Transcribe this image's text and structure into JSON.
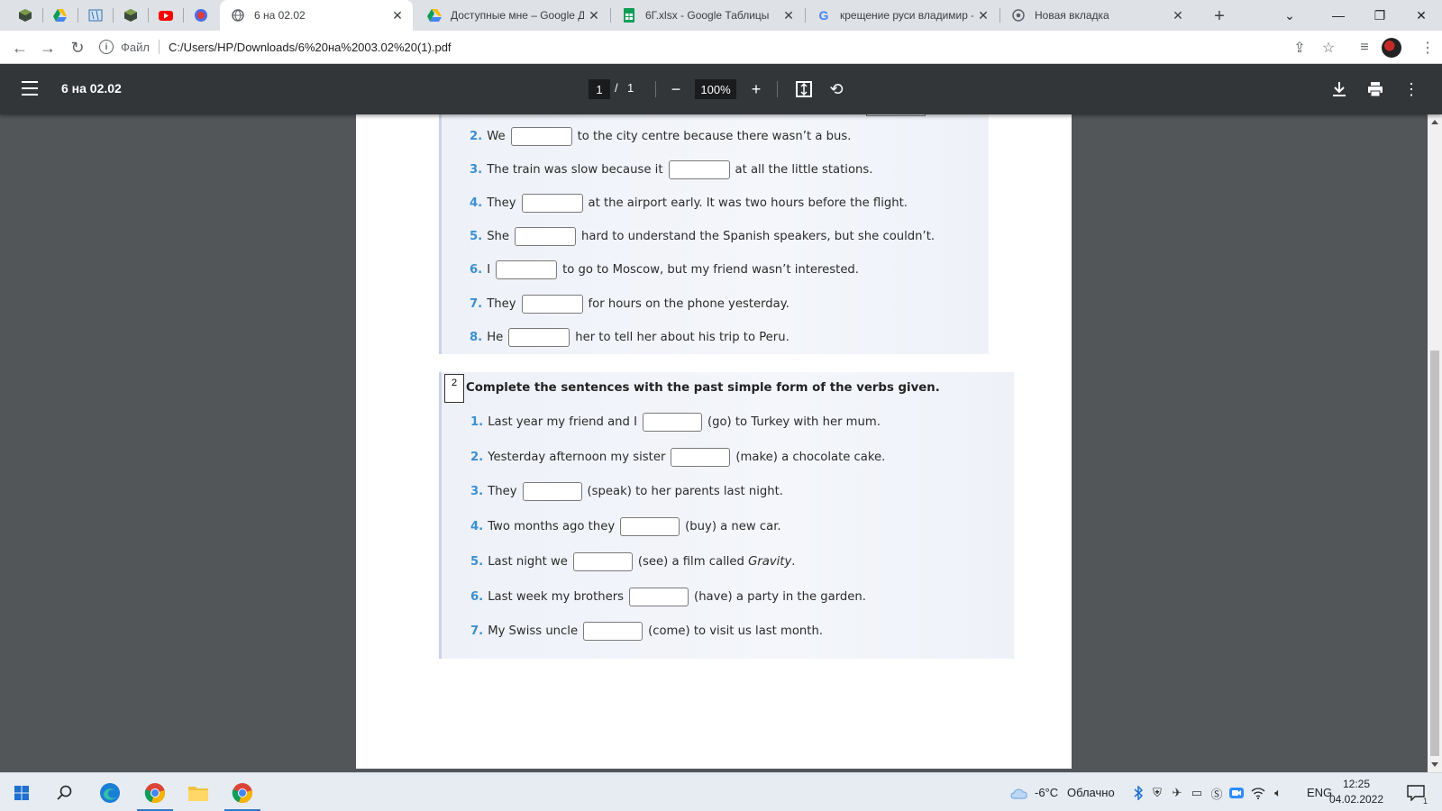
{
  "browser": {
    "tabs": [
      {
        "title": "6 на 02.02",
        "active": true,
        "icon": "globe-icon"
      },
      {
        "title": "Доступные мне – Google Ди",
        "active": false,
        "icon": "google-drive-icon"
      },
      {
        "title": "6Г.xlsx - Google Таблицы",
        "active": false,
        "icon": "google-sheets-icon"
      },
      {
        "title": "крещение руси владимир -",
        "active": false,
        "icon": "google-icon"
      },
      {
        "title": "Новая вкладка",
        "active": false,
        "icon": "chrome-icon"
      }
    ],
    "address": {
      "scheme_label": "Файл",
      "url": "C:/Users/HP/Downloads/6%20на%2003.02%20(1).pdf"
    }
  },
  "pdf_viewer": {
    "title": "6 на 02.02",
    "current_page": "1",
    "page_separator": "/",
    "total_pages": "1",
    "zoom": "100%"
  },
  "exercise1": {
    "sentences": [
      {
        "num": "2.",
        "before": "We",
        "after": "to the city centre because there wasn’t a bus."
      },
      {
        "num": "3.",
        "before": "The train was slow because it",
        "after": "at all the little stations."
      },
      {
        "num": "4.",
        "before": "They",
        "after": "at the airport early. It was two hours before the flight."
      },
      {
        "num": "5.",
        "before": "She",
        "after": "hard to understand the Spanish speakers, but she couldn’t."
      },
      {
        "num": "6.",
        "before": "I",
        "after": "to go to Moscow, but my friend wasn’t interested."
      },
      {
        "num": "7.",
        "before": "They",
        "after": "for hours on the phone yesterday."
      },
      {
        "num": "8.",
        "before": "He",
        "after": "her to tell her about his trip to Peru."
      }
    ]
  },
  "exercise2": {
    "number": "2",
    "title": "Complete the sentences with the past simple form of the verbs given.",
    "sentences": [
      {
        "num": "1.",
        "before": "Last year my friend and I",
        "after": "(go) to Turkey with her mum."
      },
      {
        "num": "2.",
        "before": "Yesterday afternoon my sister",
        "after": "(make) a chocolate cake."
      },
      {
        "num": "3.",
        "before": "They",
        "after": "(speak) to her parents last night."
      },
      {
        "num": "4.",
        "before": "Two months ago they",
        "after": "(buy) a new car."
      },
      {
        "num": "5.",
        "before": "Last night we",
        "after": "(see) a film called",
        "italic": "Gravity",
        "end": "."
      },
      {
        "num": "6.",
        "before": "Last week my brothers",
        "after": "(have) a party in the garden."
      },
      {
        "num": "7.",
        "before": "My Swiss uncle",
        "after": "(come) to visit us last month."
      }
    ]
  },
  "taskbar": {
    "weather": "-6°C",
    "weather_desc": "Облачно",
    "language": "ENG",
    "time": "12:25",
    "date": "04.02.2022",
    "notification_count": "1"
  },
  "colors": {
    "pdf_toolbar": "#323639",
    "viewer_bg": "#525659",
    "exercise_number": "#3a8fd2",
    "tabstrip": "#dee1e6"
  }
}
